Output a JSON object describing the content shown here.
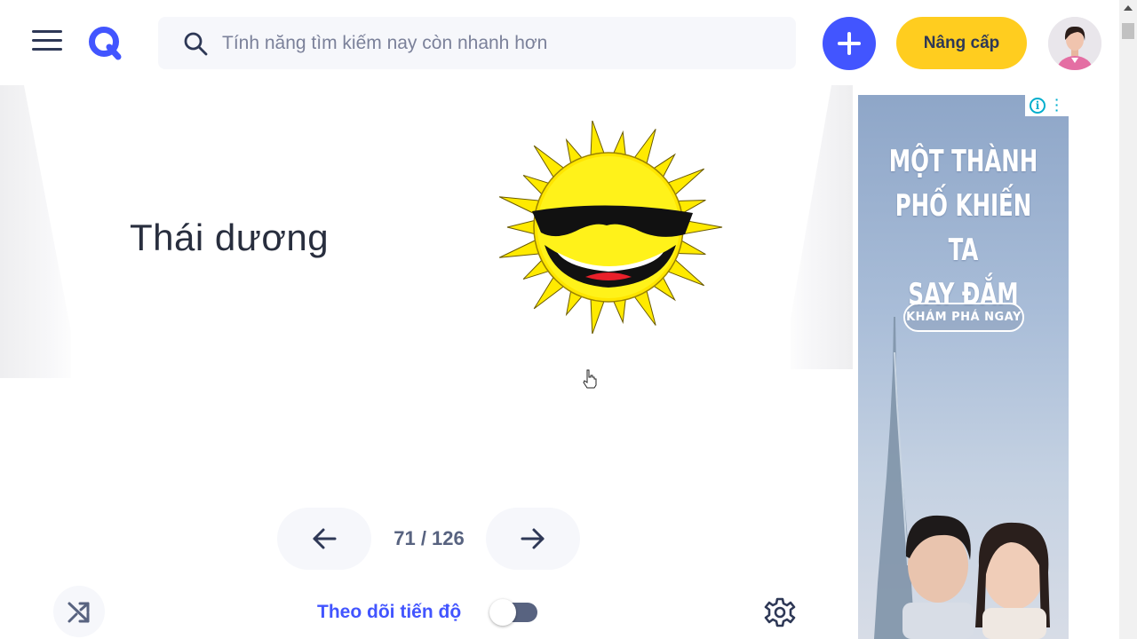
{
  "header": {
    "search_placeholder": "Tính năng tìm kiếm nay còn nhanh hơn",
    "upgrade_label": "Nâng cấp"
  },
  "flashcard": {
    "term": "Thái dương",
    "image": "cartoon-sun-with-sunglasses"
  },
  "navigation": {
    "counter": "71 / 126",
    "current": 71,
    "total": 126
  },
  "footer": {
    "track_progress_label": "Theo dõi tiến độ",
    "track_progress_on": false
  },
  "ad": {
    "headline_lines": [
      "MỘT THÀNH",
      "PHỐ KHIẾN TA",
      "SAY ĐẮM"
    ],
    "cta": "KHÁM PHÁ NGAY"
  },
  "colors": {
    "brand": "#4255ff",
    "upgrade": "#ffcd1f",
    "text": "#282e3e",
    "muted": "#586380"
  },
  "icons": {
    "menu": "hamburger-icon",
    "logo": "quizlet-q-icon",
    "search": "search-icon",
    "add": "plus-icon",
    "prev": "arrow-left-icon",
    "next": "arrow-right-icon",
    "shuffle": "shuffle-icon",
    "settings": "gear-icon"
  }
}
